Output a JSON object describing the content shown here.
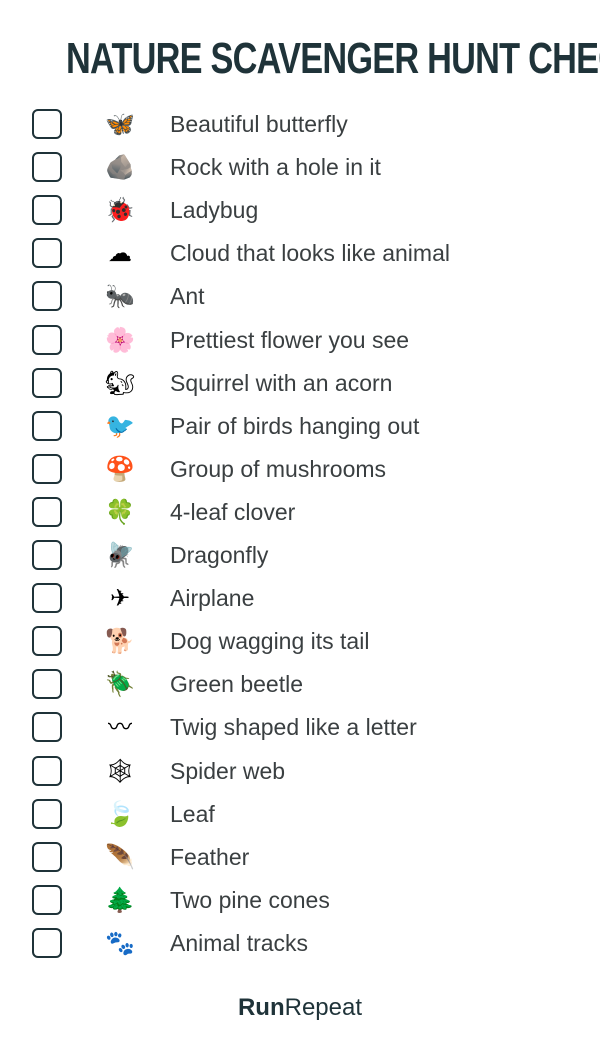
{
  "title": "NATURE SCAVENGER HUNT CHECKLIST",
  "items": [
    {
      "label": "Beautiful butterfly",
      "icon": "butterfly-icon",
      "glyph": "🦋"
    },
    {
      "label": "Rock with a hole in it",
      "icon": "rock-icon",
      "glyph": "🪨"
    },
    {
      "label": "Ladybug",
      "icon": "ladybug-icon",
      "glyph": "🐞"
    },
    {
      "label": "Cloud that looks like animal",
      "icon": "cloud-icon",
      "glyph": "☁"
    },
    {
      "label": "Ant",
      "icon": "ant-icon",
      "glyph": "🐜"
    },
    {
      "label": "Prettiest flower you see",
      "icon": "flower-icon",
      "glyph": "🌸"
    },
    {
      "label": "Squirrel with an acorn",
      "icon": "squirrel-icon",
      "glyph": "🐿"
    },
    {
      "label": "Pair of birds hanging out",
      "icon": "birds-icon",
      "glyph": "🐦"
    },
    {
      "label": "Group of mushrooms",
      "icon": "mushroom-icon",
      "glyph": "🍄"
    },
    {
      "label": "4-leaf clover",
      "icon": "clover-icon",
      "glyph": "🍀"
    },
    {
      "label": "Dragonfly",
      "icon": "dragonfly-icon",
      "glyph": "🪰"
    },
    {
      "label": "Airplane",
      "icon": "airplane-icon",
      "glyph": "✈"
    },
    {
      "label": "Dog wagging its tail",
      "icon": "dog-icon",
      "glyph": "🐕"
    },
    {
      "label": "Green beetle",
      "icon": "beetle-icon",
      "glyph": "🪲"
    },
    {
      "label": "Twig shaped like a letter",
      "icon": "twig-icon",
      "glyph": "〰"
    },
    {
      "label": "Spider web",
      "icon": "spider-web-icon",
      "glyph": "🕸"
    },
    {
      "label": "Leaf",
      "icon": "leaf-icon",
      "glyph": "🍃"
    },
    {
      "label": "Feather",
      "icon": "feather-icon",
      "glyph": "🪶"
    },
    {
      "label": "Two pine cones",
      "icon": "pine-cone-icon",
      "glyph": "🌲"
    },
    {
      "label": "Animal tracks",
      "icon": "animal-tracks-icon",
      "glyph": "🐾"
    }
  ],
  "footer": {
    "brand_bold": "Run",
    "brand_light": "Repeat"
  }
}
